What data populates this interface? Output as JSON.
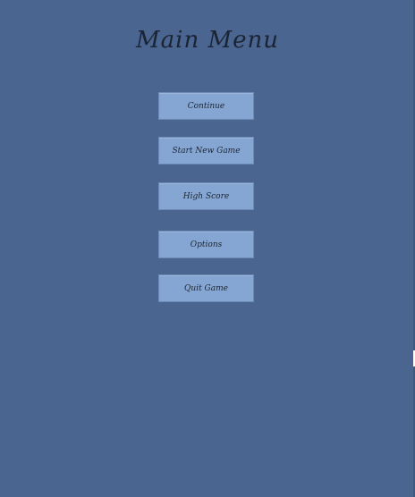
{
  "menu": {
    "title": "Main Menu",
    "buttons": {
      "continue": "Continue",
      "start_new_game": "Start New Game",
      "high_score": "High Score",
      "options": "Options",
      "quit_game": "Quit Game"
    }
  },
  "colors": {
    "background": "#4a658f",
    "button": "#85a6d2",
    "text": "#1d2533"
  }
}
